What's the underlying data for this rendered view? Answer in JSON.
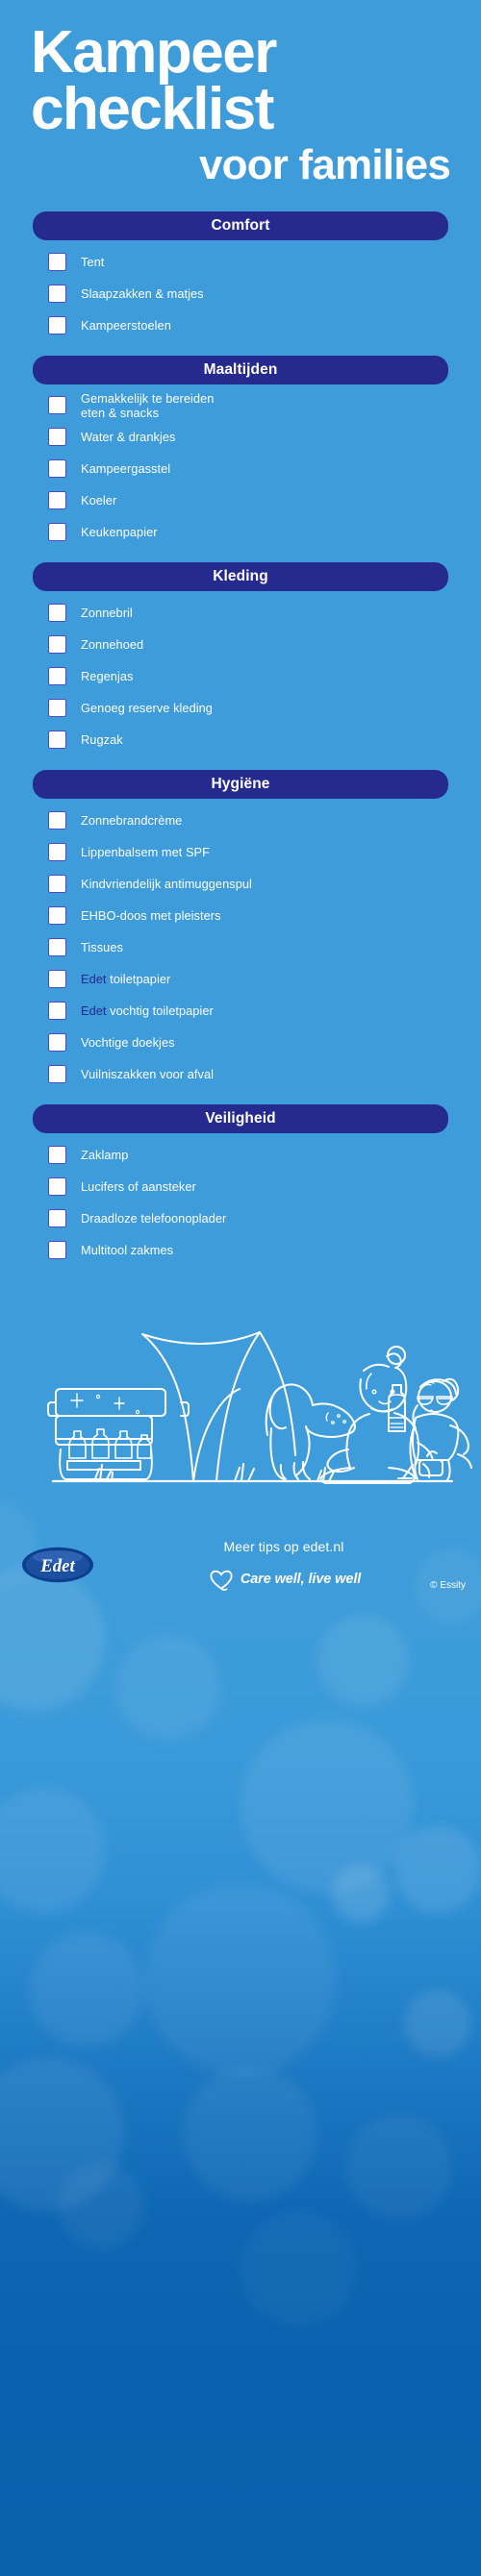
{
  "title": {
    "line1": "Kampeer",
    "line2": "checklist",
    "line3": "voor families"
  },
  "colors": {
    "background_top": "#3d9cd9",
    "background_bottom": "#0a61ac",
    "section_header": "#262a8e",
    "checkbox_border": "#4b49c4",
    "text": "#ffffff",
    "brand_highlight": "#262a8e"
  },
  "sections": [
    {
      "title": "Comfort",
      "items": [
        {
          "label": "Tent",
          "brand": ""
        },
        {
          "label": "Slaapzakken & matjes",
          "brand": ""
        },
        {
          "label": "Kampeerstoelen",
          "brand": ""
        }
      ]
    },
    {
      "title": "Maaltijden",
      "items": [
        {
          "label": "Gemakkelijk te bereiden\neten & snacks",
          "brand": ""
        },
        {
          "label": "Water & drankjes",
          "brand": ""
        },
        {
          "label": "Kampeergasstel",
          "brand": ""
        },
        {
          "label": "Koeler",
          "brand": ""
        },
        {
          "label": "Keukenpapier",
          "brand": ""
        }
      ]
    },
    {
      "title": "Kleding",
      "items": [
        {
          "label": "Zonnebril",
          "brand": ""
        },
        {
          "label": "Zonnehoed",
          "brand": ""
        },
        {
          "label": "Regenjas",
          "brand": ""
        },
        {
          "label": "Genoeg reserve kleding",
          "brand": ""
        },
        {
          "label": "Rugzak",
          "brand": ""
        }
      ]
    },
    {
      "title": "Hygiëne",
      "items": [
        {
          "label": "Zonnebrandcrème",
          "brand": ""
        },
        {
          "label": "Lippenbalsem met SPF",
          "brand": ""
        },
        {
          "label": "Kindvriendelijk antimuggenspul",
          "brand": ""
        },
        {
          "label": "EHBO-doos met pleisters",
          "brand": ""
        },
        {
          "label": "Tissues",
          "brand": ""
        },
        {
          "label": "toiletpapier",
          "brand": "Edet"
        },
        {
          "label": "vochtig toiletpapier",
          "brand": "Edet"
        },
        {
          "label": "Vochtige doekjes",
          "brand": ""
        },
        {
          "label": "Vuilniszakken voor afval",
          "brand": ""
        }
      ]
    },
    {
      "title": "Veiligheid",
      "items": [
        {
          "label": "Zaklamp",
          "brand": ""
        },
        {
          "label": "Lucifers of aansteker",
          "brand": ""
        },
        {
          "label": "Draadloze telefoonoplader",
          "brand": ""
        },
        {
          "label": "Multitool zakmes",
          "brand": ""
        }
      ]
    }
  ],
  "footer": {
    "logo_text": "Edet",
    "tips": "Meer tips op edet.nl",
    "tagline": "Care well, live well",
    "copyright": "© Essity"
  }
}
